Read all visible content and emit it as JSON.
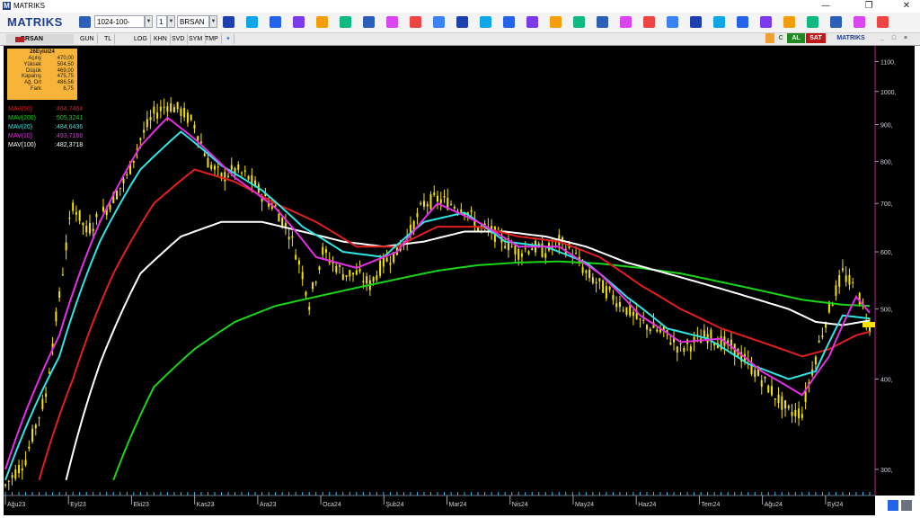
{
  "window": {
    "title": "MATRIKS",
    "logo_letter": "M",
    "minimize": "—",
    "restore": "❐",
    "close": "✕"
  },
  "toolbar": {
    "brand": "MATRIKS",
    "template_value": "1024-100-BEYA",
    "count_value": "1",
    "symbol_value": "BRSAN",
    "icons": [
      "save-icon",
      "zoom-out-icon",
      "crosshair-icon",
      "indicators-icon",
      "draw-icon",
      "clock-icon",
      "layers-icon",
      "bold-icon",
      "italic-icon",
      "arrow-icon",
      "underline-icon",
      "compare-icon",
      "template-icon",
      "fibo-icon",
      "function-icon",
      "list-icon",
      "grid-icon",
      "table-icon",
      "window-icon",
      "search-icon",
      "filter-icon",
      "dollar-icon",
      "edit-icon",
      "settings-icon",
      "cut-icon",
      "user-icon",
      "bell-icon",
      "mail-icon",
      "stock-icon",
      "share-icon"
    ]
  },
  "tabs": {
    "symbol": "BRSAN",
    "periods": [
      "GUN",
      "TL",
      "LOG",
      "KHN",
      "SVD",
      "SYM",
      "TMP"
    ],
    "al_label": "AL",
    "sat_label": "SAT",
    "brand_small": "MATRIKS"
  },
  "info": {
    "date": "26Eylül24",
    "rows": [
      {
        "label": "Açılış",
        "value": "470,00"
      },
      {
        "label": "Yüksek",
        "value": "504,50"
      },
      {
        "label": "Düşük",
        "value": "469,00"
      },
      {
        "label": "Kapanış",
        "value": "475,75"
      },
      {
        "label": "Ağ. Ort",
        "value": "486,56"
      },
      {
        "label": "Fark",
        "value": "6,75"
      }
    ]
  },
  "mavs": [
    {
      "name": "MAV(50)",
      "value": ":464,7464",
      "color": "#e31e1e"
    },
    {
      "name": "MAV(200)",
      "value": ":505,3241",
      "color": "#19d619"
    },
    {
      "name": "MAV(20)",
      "value": ":484,6436",
      "color": "#2ee6e6"
    },
    {
      "name": "MAV(10)",
      "value": ":493,7168",
      "color": "#e62ee6"
    },
    {
      "name": "MAV(100)",
      "value": ":482,3718",
      "color": "#ffffff"
    }
  ],
  "chart_data": {
    "type": "line",
    "scale": "log",
    "y_ticks": [
      "1100,",
      "1000,",
      "900,",
      "800,",
      "700,",
      "600,",
      "500,",
      "400,",
      "300,"
    ],
    "x_labels": [
      "Ağu23",
      "Eyl23",
      "Eki23",
      "Kas23",
      "Ara23",
      "Oca24",
      "Şub24",
      "Mar24",
      "Nis24",
      "May24",
      "Haz24",
      "Tem24",
      "Ağu24",
      "Eyl24"
    ],
    "ylim": [
      280,
      1150
    ],
    "last_price": 475.75,
    "price_shape": [
      [
        0,
        285
      ],
      [
        3,
        310
      ],
      [
        6,
        380
      ],
      [
        8,
        520
      ],
      [
        10,
        700
      ],
      [
        12,
        640
      ],
      [
        15,
        690
      ],
      [
        18,
        760
      ],
      [
        20,
        860
      ],
      [
        22,
        930
      ],
      [
        24,
        960
      ],
      [
        26,
        940
      ],
      [
        28,
        900
      ],
      [
        30,
        800
      ],
      [
        32,
        760
      ],
      [
        34,
        780
      ],
      [
        36,
        760
      ],
      [
        38,
        720
      ],
      [
        40,
        690
      ],
      [
        42,
        640
      ],
      [
        44,
        560
      ],
      [
        45,
        510
      ],
      [
        47,
        600
      ],
      [
        50,
        560
      ],
      [
        52,
        560
      ],
      [
        54,
        540
      ],
      [
        56,
        580
      ],
      [
        58,
        600
      ],
      [
        60,
        640
      ],
      [
        62,
        700
      ],
      [
        64,
        710
      ],
      [
        66,
        700
      ],
      [
        68,
        690
      ],
      [
        70,
        650
      ],
      [
        72,
        640
      ],
      [
        74,
        620
      ],
      [
        76,
        600
      ],
      [
        78,
        610
      ],
      [
        80,
        600
      ],
      [
        82,
        620
      ],
      [
        84,
        600
      ],
      [
        86,
        560
      ],
      [
        88,
        540
      ],
      [
        90,
        520
      ],
      [
        92,
        500
      ],
      [
        94,
        480
      ],
      [
        96,
        470
      ],
      [
        98,
        460
      ],
      [
        100,
        440
      ],
      [
        102,
        450
      ],
      [
        104,
        460
      ],
      [
        106,
        450
      ],
      [
        108,
        440
      ],
      [
        110,
        420
      ],
      [
        112,
        400
      ],
      [
        114,
        380
      ],
      [
        116,
        360
      ],
      [
        118,
        360
      ],
      [
        120,
        430
      ],
      [
        122,
        500
      ],
      [
        124,
        560
      ],
      [
        126,
        530
      ],
      [
        128,
        476
      ]
    ],
    "mav_shapes": {
      "MAV(10)": [
        [
          0,
          300
        ],
        [
          8,
          460
        ],
        [
          14,
          660
        ],
        [
          20,
          840
        ],
        [
          24,
          920
        ],
        [
          28,
          860
        ],
        [
          34,
          760
        ],
        [
          40,
          690
        ],
        [
          46,
          590
        ],
        [
          52,
          570
        ],
        [
          58,
          600
        ],
        [
          64,
          700
        ],
        [
          70,
          660
        ],
        [
          76,
          610
        ],
        [
          82,
          610
        ],
        [
          88,
          560
        ],
        [
          94,
          490
        ],
        [
          100,
          450
        ],
        [
          106,
          455
        ],
        [
          112,
          410
        ],
        [
          118,
          380
        ],
        [
          122,
          430
        ],
        [
          126,
          520
        ],
        [
          128,
          494
        ]
      ],
      "MAV(20)": [
        [
          0,
          290
        ],
        [
          8,
          430
        ],
        [
          14,
          620
        ],
        [
          20,
          780
        ],
        [
          26,
          880
        ],
        [
          32,
          790
        ],
        [
          38,
          730
        ],
        [
          44,
          650
        ],
        [
          50,
          600
        ],
        [
          56,
          590
        ],
        [
          62,
          660
        ],
        [
          68,
          680
        ],
        [
          74,
          620
        ],
        [
          80,
          610
        ],
        [
          86,
          580
        ],
        [
          92,
          520
        ],
        [
          98,
          470
        ],
        [
          104,
          455
        ],
        [
          110,
          420
        ],
        [
          116,
          400
        ],
        [
          120,
          410
        ],
        [
          124,
          490
        ],
        [
          128,
          485
        ]
      ],
      "MAV(50)": [
        [
          5,
          290
        ],
        [
          10,
          400
        ],
        [
          16,
          560
        ],
        [
          22,
          700
        ],
        [
          28,
          780
        ],
        [
          34,
          750
        ],
        [
          40,
          700
        ],
        [
          46,
          660
        ],
        [
          52,
          610
        ],
        [
          58,
          610
        ],
        [
          64,
          650
        ],
        [
          70,
          650
        ],
        [
          76,
          630
        ],
        [
          82,
          620
        ],
        [
          88,
          590
        ],
        [
          94,
          540
        ],
        [
          100,
          500
        ],
        [
          106,
          470
        ],
        [
          112,
          450
        ],
        [
          118,
          430
        ],
        [
          122,
          440
        ],
        [
          126,
          460
        ],
        [
          128,
          465
        ]
      ],
      "MAV(100)": [
        [
          9,
          290
        ],
        [
          14,
          420
        ],
        [
          20,
          560
        ],
        [
          26,
          630
        ],
        [
          32,
          660
        ],
        [
          38,
          660
        ],
        [
          44,
          640
        ],
        [
          50,
          620
        ],
        [
          56,
          610
        ],
        [
          62,
          620
        ],
        [
          68,
          640
        ],
        [
          74,
          640
        ],
        [
          80,
          630
        ],
        [
          86,
          610
        ],
        [
          92,
          580
        ],
        [
          98,
          560
        ],
        [
          104,
          540
        ],
        [
          110,
          520
        ],
        [
          116,
          500
        ],
        [
          120,
          480
        ],
        [
          124,
          475
        ],
        [
          128,
          482
        ]
      ],
      "MAV(200)": [
        [
          16,
          290
        ],
        [
          22,
          390
        ],
        [
          28,
          440
        ],
        [
          34,
          480
        ],
        [
          40,
          505
        ],
        [
          46,
          520
        ],
        [
          52,
          535
        ],
        [
          58,
          550
        ],
        [
          64,
          565
        ],
        [
          70,
          575
        ],
        [
          76,
          580
        ],
        [
          82,
          582
        ],
        [
          88,
          578
        ],
        [
          94,
          570
        ],
        [
          100,
          560
        ],
        [
          106,
          545
        ],
        [
          112,
          530
        ],
        [
          118,
          515
        ],
        [
          124,
          507
        ],
        [
          128,
          505
        ]
      ]
    }
  }
}
